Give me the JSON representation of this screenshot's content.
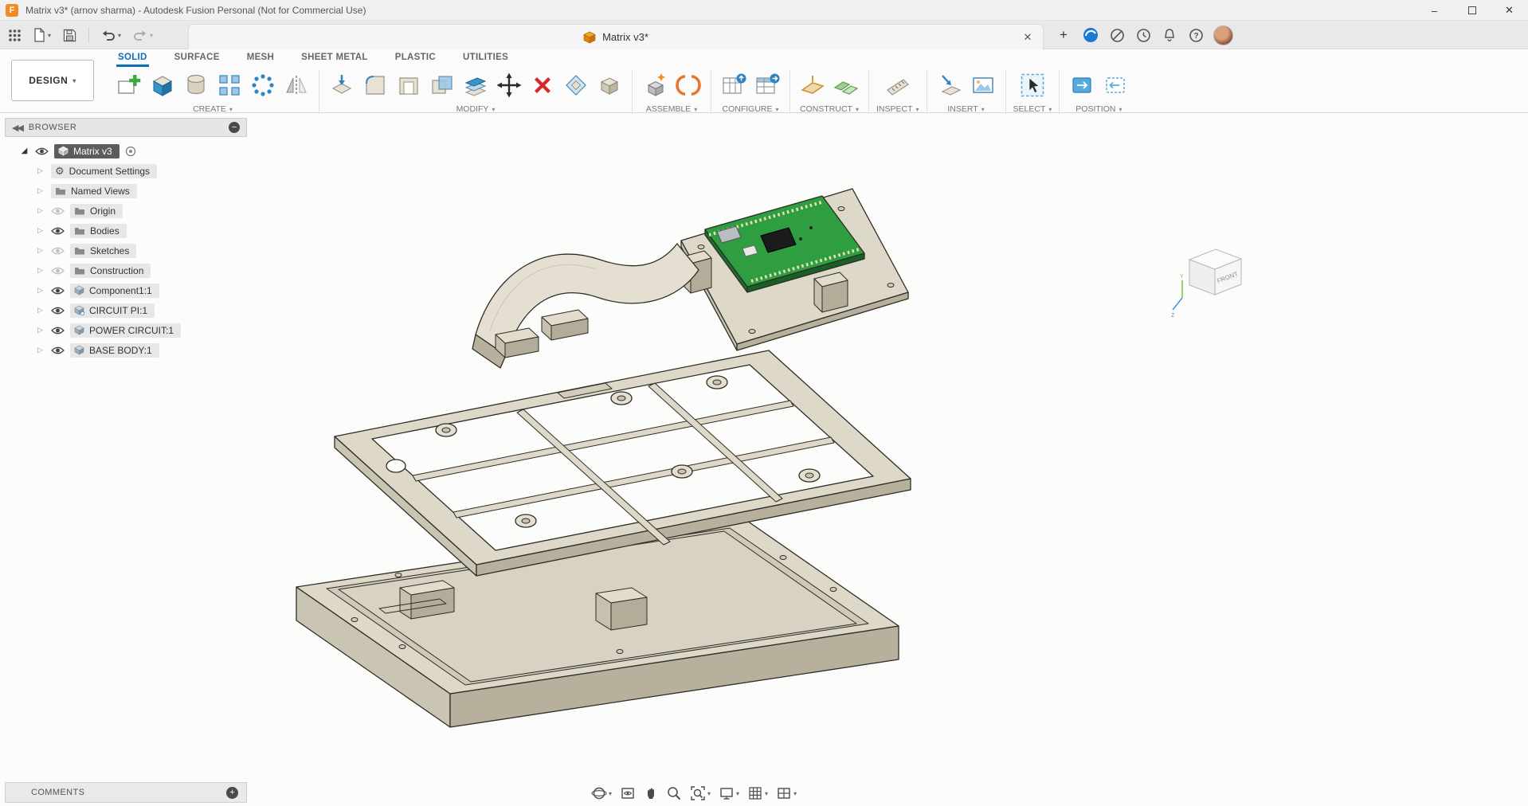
{
  "titlebar": {
    "title": "Matrix v3* (arnov sharma) - Autodesk Fusion Personal (Not for Commercial Use)"
  },
  "tabbar": {
    "document_tab": "Matrix v3*",
    "left_icons": [
      "app-grid-icon",
      "file-icon",
      "save-icon",
      "undo-icon",
      "redo-icon"
    ],
    "right_icons": [
      "new-tab-icon",
      "job-status-icon",
      "extensions-icon",
      "history-icon",
      "notifications-bell-icon",
      "help-icon",
      "avatar"
    ]
  },
  "ribbon": {
    "workspace": "DESIGN",
    "active_tab": "SOLID",
    "tabs": [
      "SOLID",
      "SURFACE",
      "MESH",
      "SHEET METAL",
      "PLASTIC",
      "UTILITIES"
    ],
    "groups": [
      {
        "label": "CREATE",
        "tools": [
          "create-sketch",
          "box",
          "cylinder",
          "rectangular-pattern",
          "sphere",
          "mirror"
        ]
      },
      {
        "label": "MODIFY",
        "tools": [
          "press-pull",
          "fillet",
          "shell",
          "combine",
          "offset-face",
          "move",
          "delete",
          "scale",
          "replace-face"
        ]
      },
      {
        "label": "ASSEMBLE",
        "tools": [
          "new-component",
          "joint"
        ]
      },
      {
        "label": "CONFIGURE",
        "tools": [
          "configuration",
          "configuration-table"
        ]
      },
      {
        "label": "CONSTRUCT",
        "tools": [
          "offset-plane",
          "midplane"
        ]
      },
      {
        "label": "INSPECT",
        "tools": [
          "measure"
        ]
      },
      {
        "label": "INSERT",
        "tools": [
          "insert-derive",
          "canvas"
        ]
      },
      {
        "label": "SELECT",
        "tools": [
          "select"
        ]
      },
      {
        "label": "POSITION",
        "tools": [
          "capture-position",
          "revert-position"
        ]
      }
    ]
  },
  "browser": {
    "title": "BROWSER",
    "root": {
      "label": "Matrix v3",
      "eye": "on"
    },
    "items": [
      {
        "label": "Document Settings",
        "icon": "gear",
        "eye": "none"
      },
      {
        "label": "Named Views",
        "icon": "folder",
        "eye": "none"
      },
      {
        "label": "Origin",
        "icon": "folder",
        "eye": "off"
      },
      {
        "label": "Bodies",
        "icon": "folder",
        "eye": "on"
      },
      {
        "label": "Sketches",
        "icon": "folder",
        "eye": "off"
      },
      {
        "label": "Construction",
        "icon": "folder",
        "eye": "off"
      },
      {
        "label": "Component1:1",
        "icon": "component",
        "eye": "on"
      },
      {
        "label": "CIRCUIT PI:1",
        "icon": "component",
        "eye": "on"
      },
      {
        "label": "POWER CIRCUIT:1",
        "icon": "component",
        "eye": "on"
      },
      {
        "label": "BASE BODY:1",
        "icon": "component",
        "eye": "on"
      }
    ]
  },
  "viewcube": {
    "front_label": "FRONT",
    "axis_y": "Y",
    "axis_z": "Z"
  },
  "canvas": {
    "model": "exploded-case-assembly-with-raspberry-pi-pico"
  },
  "comments": {
    "label": "COMMENTS"
  },
  "navbar": {
    "icons": [
      "orbit",
      "look-at",
      "pan",
      "zoom",
      "fit",
      "display-settings",
      "grid-snaps",
      "viewports"
    ]
  },
  "colors": {
    "accent": "#0a70b8",
    "model_face": "#ddd8c8",
    "pcb_green": "#2f9e41",
    "delete_red": "#d42a2a",
    "logo_orange": "#f6891f"
  }
}
